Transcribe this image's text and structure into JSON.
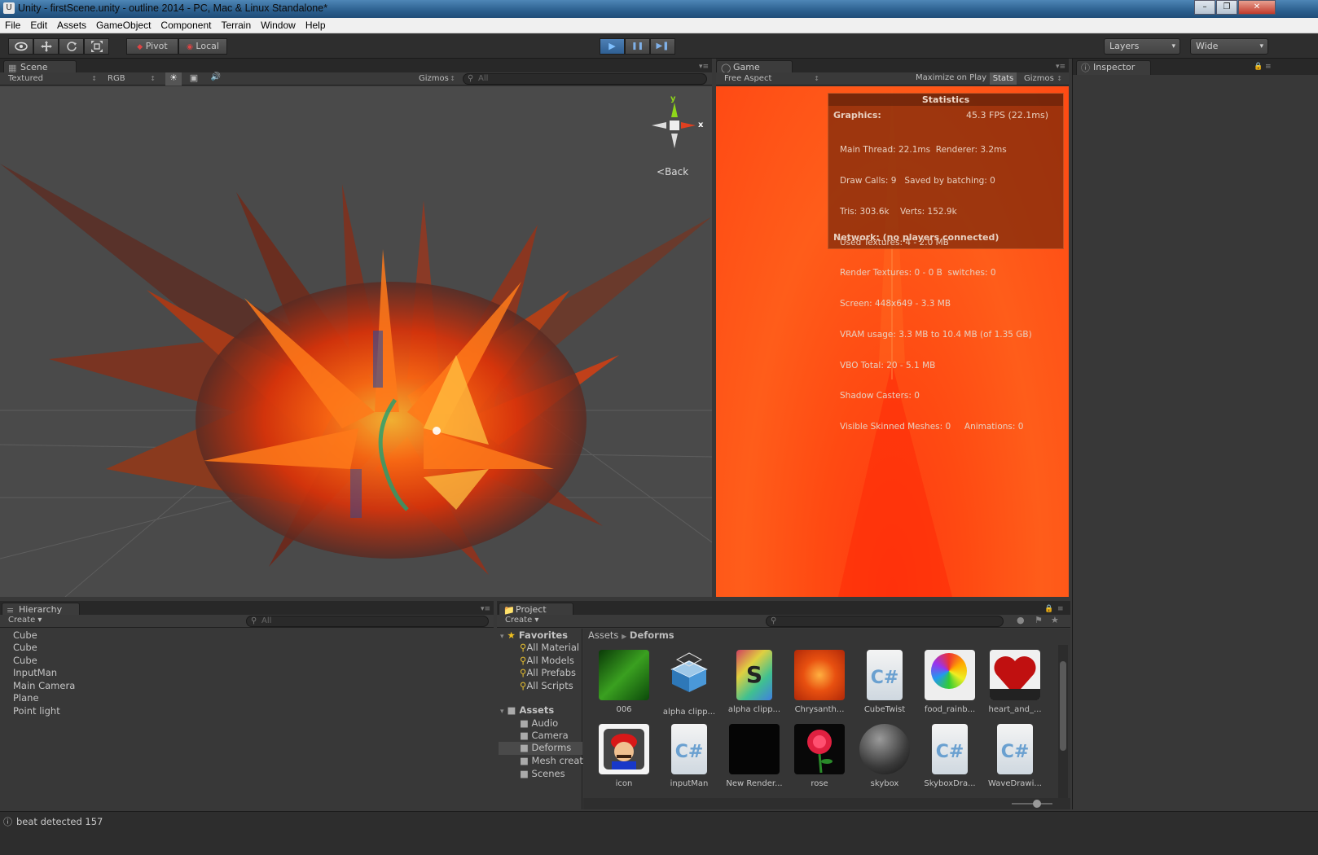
{
  "window": {
    "title": "Unity - firstScene.unity - outline 2014 - PC, Mac & Linux Standalone*",
    "app_icon": "U",
    "minimize": "–",
    "maximize": "❐",
    "close": "✕"
  },
  "menu": [
    "File",
    "Edit",
    "Assets",
    "GameObject",
    "Component",
    "Terrain",
    "Window",
    "Help"
  ],
  "toolbar": {
    "tools": [
      "eye-icon",
      "move-icon",
      "rotate-icon",
      "scale-icon"
    ],
    "pivot": "Pivot",
    "local": "Local",
    "play": "▶",
    "pause": "❚❚",
    "step": "▶❚",
    "layers": "Layers",
    "layout": "Wide"
  },
  "scene": {
    "tab": "Scene",
    "render_mode": "Textured",
    "color_mode": "RGB",
    "gizmos": "Gizmos",
    "search_placeholder": "All",
    "gizmo_y": "y",
    "gizmo_x": "x",
    "view_label": "Back"
  },
  "game": {
    "tab": "Game",
    "aspect": "Free Aspect",
    "maximize": "Maximize on Play",
    "stats": "Stats",
    "gizmos": "Gizmos",
    "statistics": {
      "header": "Statistics",
      "graphics_label": "Graphics:",
      "fps": "45.3 FPS (22.1ms)",
      "lines": [
        "Main Thread: 22.1ms  Renderer: 3.2ms",
        "Draw Calls: 9   Saved by batching: 0",
        "Tris: 303.6k    Verts: 152.9k",
        "Used Textures: 4 - 2.0 MB",
        "Render Textures: 0 - 0 B  switches: 0",
        "Screen: 448x649 - 3.3 MB",
        "VRAM usage: 3.3 MB to 10.4 MB (of 1.35 GB)",
        "VBO Total: 20 - 5.1 MB",
        "Shadow Casters: 0",
        "Visible Skinned Meshes: 0     Animations: 0"
      ],
      "network": "Network: (no players connected)"
    }
  },
  "inspector": {
    "tab": "Inspector"
  },
  "hierarchy": {
    "tab": "Hierarchy",
    "create": "Create",
    "search_placeholder": "All",
    "items": [
      "Cube",
      "Cube",
      "Cube",
      "InputMan",
      "Main Camera",
      "Plane",
      "Point light"
    ]
  },
  "project": {
    "tab": "Project",
    "create": "Create",
    "favorites_label": "Favorites",
    "favorites": [
      "All Material",
      "All Models",
      "All Prefabs",
      "All Scripts"
    ],
    "assets_label": "Assets",
    "folders": [
      "Audio",
      "Camera",
      "Deforms",
      "Mesh creat",
      "Scenes"
    ],
    "breadcrumb": [
      "Assets",
      "Deforms"
    ],
    "assets": [
      {
        "name": "006",
        "icon": "texture-leaf"
      },
      {
        "name": "alpha clipp...",
        "icon": "mesh-icon"
      },
      {
        "name": "alpha clipp...",
        "icon": "shader-icon"
      },
      {
        "name": "Chrysanth...",
        "icon": "texture-flower"
      },
      {
        "name": "CubeTwist",
        "icon": "csharp-script-icon"
      },
      {
        "name": "food_rainb...",
        "icon": "texture-lollipop"
      },
      {
        "name": "heart_and_...",
        "icon": "texture-heart"
      },
      {
        "name": "icon",
        "icon": "texture-mario"
      },
      {
        "name": "inputMan",
        "icon": "csharp-script-icon"
      },
      {
        "name": "New Render...",
        "icon": "render-texture"
      },
      {
        "name": "rose",
        "icon": "texture-rose"
      },
      {
        "name": "skybox",
        "icon": "material-sphere"
      },
      {
        "name": "SkyboxDra...",
        "icon": "csharp-script-icon"
      },
      {
        "name": "WaveDrawi...",
        "icon": "csharp-script-icon"
      }
    ],
    "csharp_label": "C#",
    "shader_label": "S"
  },
  "status": {
    "message": "beat detected 157"
  },
  "colors": {
    "accent": "#3d6fa8",
    "play_active": "#4d7fb5"
  }
}
